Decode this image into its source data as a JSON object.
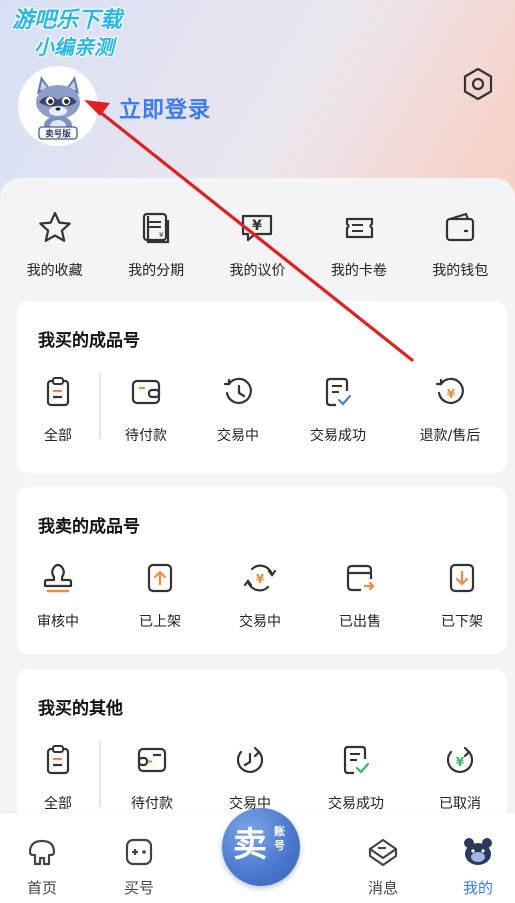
{
  "watermark": {
    "line1": "游吧乐下载",
    "line2": "小编亲测"
  },
  "header": {
    "login_label": "立即登录",
    "avatar_caption": "卖号"
  },
  "quick_links": [
    {
      "label": "我的收藏",
      "icon": "star-icon"
    },
    {
      "label": "我的分期",
      "icon": "installment-icon"
    },
    {
      "label": "我的议价",
      "icon": "bargain-icon"
    },
    {
      "label": "我的卡卷",
      "icon": "coupon-icon"
    },
    {
      "label": "我的钱包",
      "icon": "wallet-icon"
    }
  ],
  "buy_finished": {
    "title": "我买的成品号",
    "items": [
      {
        "label": "全部",
        "icon": "clipboard-icon"
      },
      {
        "label": "待付款",
        "icon": "wallet-pay-icon"
      },
      {
        "label": "交易中",
        "icon": "clock-icon"
      },
      {
        "label": "交易成功",
        "icon": "doc-check-icon"
      },
      {
        "label": "退款/售后",
        "icon": "refund-icon"
      }
    ]
  },
  "sell_finished": {
    "title": "我卖的成品号",
    "items": [
      {
        "label": "审核中",
        "icon": "stamp-icon"
      },
      {
        "label": "已上架",
        "icon": "up-shelf-icon"
      },
      {
        "label": "交易中",
        "icon": "yen-cycle-icon"
      },
      {
        "label": "已出售",
        "icon": "sold-icon"
      },
      {
        "label": "已下架",
        "icon": "down-shelf-icon"
      }
    ]
  },
  "buy_other": {
    "title": "我买的其他",
    "items": [
      {
        "label": "全部",
        "icon": "clipboard-icon"
      },
      {
        "label": "待付款",
        "icon": "wallet-pay-icon"
      },
      {
        "label": "交易中",
        "icon": "clock-icon"
      },
      {
        "label": "交易成功",
        "icon": "doc-check-icon"
      },
      {
        "label": "已取消",
        "icon": "cancel-icon"
      }
    ]
  },
  "tabbar": {
    "home": "首页",
    "buy": "买号",
    "sell_main": "卖",
    "sell_sub": "账号",
    "messages": "消息",
    "mine": "我的"
  },
  "colors": {
    "accent": "#3d7bf0",
    "icon": "#333333",
    "orange": "#f08a3c",
    "arrow": "#e02020"
  }
}
